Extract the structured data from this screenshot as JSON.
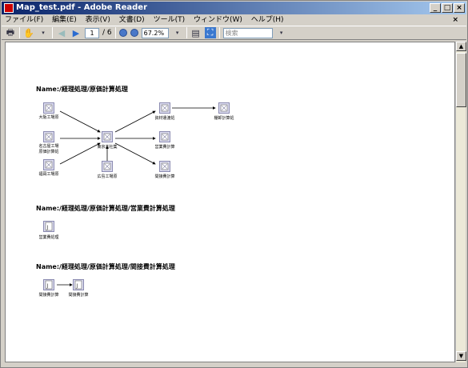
{
  "window": {
    "title": "Map_test.pdf - Adobe Reader"
  },
  "menu": [
    "ファイル(F)",
    "編集(E)",
    "表示(V)",
    "文書(D)",
    "ツール(T)",
    "ウィンドウ(W)",
    "ヘルプ(H)"
  ],
  "toolbar": {
    "page_current": "1",
    "page_total": "/ 6",
    "zoom": "67.2%",
    "search_placeholder": "検索"
  },
  "sections": [
    {
      "title": "Name:/経理処理/原価計算処理",
      "nodes": [
        {
          "id": "n1",
          "label": "大阪工場原"
        },
        {
          "id": "n2",
          "label": "名古屋工場\n原価計算処"
        },
        {
          "id": "n3",
          "label": "福岡工場原"
        },
        {
          "id": "n4",
          "label": "東京本社集"
        },
        {
          "id": "n5",
          "label": "広島工場原"
        },
        {
          "id": "n6",
          "label": "資材遣渡処"
        },
        {
          "id": "n7",
          "label": "棚卸計算処"
        },
        {
          "id": "n8",
          "label": "営業費計算"
        },
        {
          "id": "n9",
          "label": "間接費計算"
        }
      ]
    },
    {
      "title": "Name:/経理処理/原価計算処理/営業費計算処理",
      "nodes": [
        {
          "id": "m1",
          "label": "営業費処理"
        }
      ]
    },
    {
      "title": "Name:/経理処理/原価計算処理/間接費計算処理",
      "nodes": [
        {
          "id": "k1",
          "label": "間接費計算"
        },
        {
          "id": "k2",
          "label": "間接費計算"
        }
      ]
    }
  ]
}
